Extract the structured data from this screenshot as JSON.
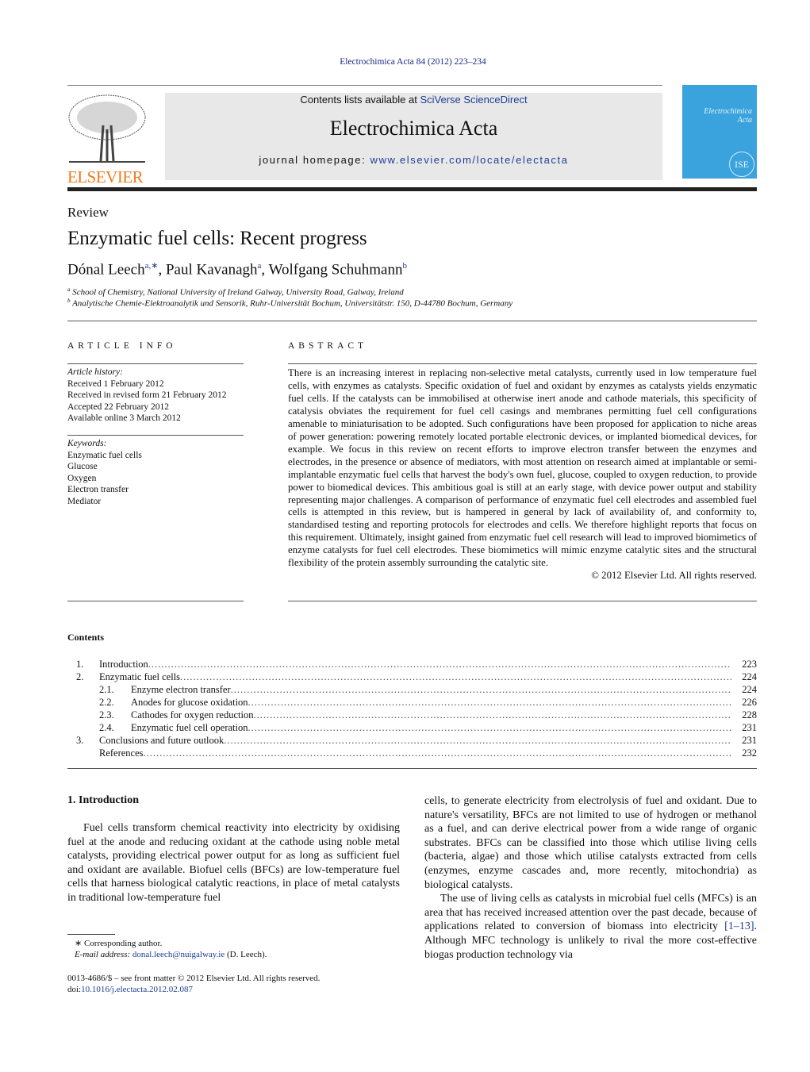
{
  "header": {
    "citation": "Electrochimica Acta 84 (2012) 223–234",
    "contents_prefix": "Contents lists available at ",
    "contents_link": "SciVerse ScienceDirect",
    "journal": "Electrochimica Acta",
    "homepage_prefix": "journal homepage: ",
    "homepage_link": "www.elsevier.com/locate/electacta",
    "publisher": "ELSEVIER",
    "cover_title": "Electrochimica Acta",
    "cover_logo": "ISE"
  },
  "article": {
    "type": "Review",
    "title": "Enzymatic fuel cells: Recent progress",
    "authors": [
      {
        "name": "Dónal Leech",
        "sup": "a,∗"
      },
      {
        "name": "Paul Kavanagh",
        "sup": "a"
      },
      {
        "name": "Wolfgang Schuhmann",
        "sup": "b"
      }
    ],
    "affiliations": [
      {
        "sup": "a",
        "text": "School of Chemistry, National University of Ireland Galway, University Road, Galway, Ireland"
      },
      {
        "sup": "b",
        "text": "Analytische Chemie-Elektroanalytik und Sensorik, Ruhr-Universität Bochum, Universitätstr. 150, D-44780 Bochum, Germany"
      }
    ]
  },
  "info": {
    "heading": "ARTICLE INFO",
    "history_label": "Article history:",
    "history": [
      "Received 1 February 2012",
      "Received in revised form 21 February 2012",
      "Accepted 22 February 2012",
      "Available online 3 March 2012"
    ],
    "keywords_label": "Keywords:",
    "keywords": [
      "Enzymatic fuel cells",
      "Glucose",
      "Oxygen",
      "Electron transfer",
      "Mediator"
    ]
  },
  "abstract": {
    "heading": "ABSTRACT",
    "text": "There is an increasing interest in replacing non-selective metal catalysts, currently used in low temperature fuel cells, with enzymes as catalysts. Specific oxidation of fuel and oxidant by enzymes as catalysts yields enzymatic fuel cells. If the catalysts can be immobilised at otherwise inert anode and cathode materials, this specificity of catalysis obviates the requirement for fuel cell casings and membranes permitting fuel cell configurations amenable to miniaturisation to be adopted. Such configurations have been proposed for application to niche areas of power generation: powering remotely located portable electronic devices, or implanted biomedical devices, for example. We focus in this review on recent efforts to improve electron transfer between the enzymes and electrodes, in the presence or absence of mediators, with most attention on research aimed at implantable or semi-implantable enzymatic fuel cells that harvest the body's own fuel, glucose, coupled to oxygen reduction, to provide power to biomedical devices. This ambitious goal is still at an early stage, with device power output and stability representing major challenges. A comparison of performance of enzymatic fuel cell electrodes and assembled fuel cells is attempted in this review, but is hampered in general by lack of availability of, and conformity to, standardised testing and reporting protocols for electrodes and cells. We therefore highlight reports that focus on this requirement. Ultimately, insight gained from enzymatic fuel cell research will lead to improved biomimetics of enzyme catalysts for fuel cell electrodes. These biomimetics will mimic enzyme catalytic sites and the structural flexibility of the protein assembly surrounding the catalytic site.",
    "copyright": "© 2012 Elsevier Ltd. All rights reserved."
  },
  "contents": {
    "heading": "Contents",
    "items": [
      {
        "num": "1.",
        "title": "Introduction",
        "page": "223",
        "sub": false
      },
      {
        "num": "2.",
        "title": "Enzymatic fuel cells",
        "page": "224",
        "sub": false
      },
      {
        "num": "2.1.",
        "title": "Enzyme electron transfer",
        "page": "224",
        "sub": true
      },
      {
        "num": "2.2.",
        "title": "Anodes for glucose oxidation",
        "page": "226",
        "sub": true
      },
      {
        "num": "2.3.",
        "title": "Cathodes for oxygen reduction",
        "page": "228",
        "sub": true
      },
      {
        "num": "2.4.",
        "title": "Enzymatic fuel cell operation",
        "page": "231",
        "sub": true
      },
      {
        "num": "3.",
        "title": "Conclusions and future outlook",
        "page": "231",
        "sub": false
      },
      {
        "num": "",
        "title": "References",
        "page": "232",
        "sub": false
      }
    ]
  },
  "body": {
    "section_heading": "1.  Introduction",
    "left_para": "Fuel cells transform chemical reactivity into electricity by oxidising fuel at the anode and reducing oxidant at the cathode using noble metal catalysts, providing electrical power output for as long as sufficient fuel and oxidant are available. Biofuel cells (BFCs) are low-temperature fuel cells that harness biological catalytic reactions, in place of metal catalysts in traditional low-temperature fuel",
    "right_para1": "cells, to generate electricity from electrolysis of fuel and oxidant. Due to nature's versatility, BFCs are not limited to use of hydrogen or methanol as a fuel, and can derive electrical power from a wide range of organic substrates. BFCs can be classified into those which utilise living cells (bacteria, algae) and those which utilise catalysts extracted from cells (enzymes, enzyme cascades and, more recently, mitochondria) as biological catalysts.",
    "right_para2_a": "The use of living cells as catalysts in microbial fuel cells (MFCs) is an area that has received increased attention over the past decade, because of applications related to conversion of biomass into electricity ",
    "right_para2_ref": "[1–13]",
    "right_para2_b": ". Although MFC technology is unlikely to rival the more cost-effective biogas production technology via"
  },
  "footnote": {
    "corresponding": "∗  Corresponding author.",
    "email_label": "E-mail address: ",
    "email": "donal.leech@nuigalway.ie",
    "email_suffix": " (D. Leech).",
    "front_matter": "0013-4686/$ – see front matter © 2012 Elsevier Ltd. All rights reserved.",
    "doi_label": "doi:",
    "doi": "10.1016/j.electacta.2012.02.087"
  },
  "colors": {
    "link": "#1a3d96",
    "publisher_orange": "#f07b1d",
    "cover_blue": "#3aa2dc",
    "banner_gray": "#e8e8e8"
  }
}
